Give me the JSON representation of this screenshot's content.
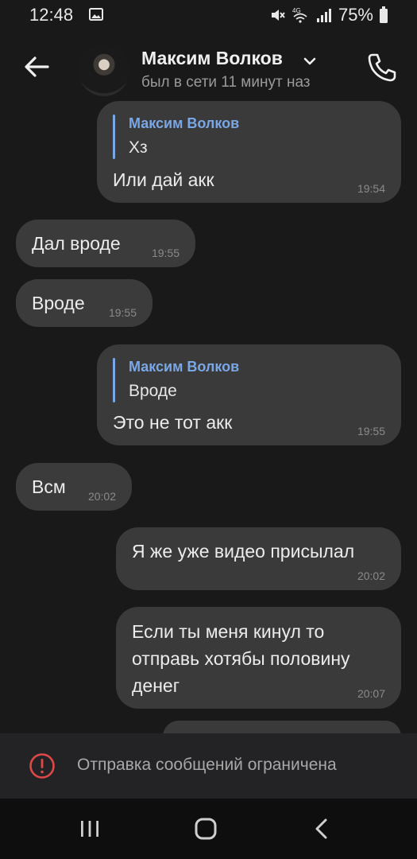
{
  "status_bar": {
    "time": "12:48",
    "battery": "75%",
    "network": "4G"
  },
  "header": {
    "contact_name": "Максим Волков",
    "contact_status": "был в сети 11 минут наз"
  },
  "messages": [
    {
      "direction": "out",
      "quote_author": "Максим Волков",
      "quote_text": "Хз",
      "text": "Или дай акк",
      "time": "19:54"
    },
    {
      "direction": "in",
      "text": "Дал вроде",
      "time": "19:55"
    },
    {
      "direction": "in",
      "text": "Вроде",
      "time": "19:55"
    },
    {
      "direction": "out",
      "quote_author": "Максим Волков",
      "quote_text": "Вроде",
      "text": "Это не тот акк",
      "time": "19:55"
    },
    {
      "direction": "in",
      "text": "Всм",
      "time": "20:02"
    },
    {
      "direction": "out",
      "text": "Я же уже видео присылал",
      "time": "20:02"
    },
    {
      "direction": "out",
      "text": "Если ты меня кинул то отправь хотябы половину денег",
      "time": "20:07"
    }
  ],
  "restriction": {
    "text": "Отправка сообщений ограничена"
  },
  "colors": {
    "background": "#19191a",
    "bubble": "#3b3b3c",
    "quote_accent": "#7aa7e6",
    "alert": "#e04848"
  }
}
